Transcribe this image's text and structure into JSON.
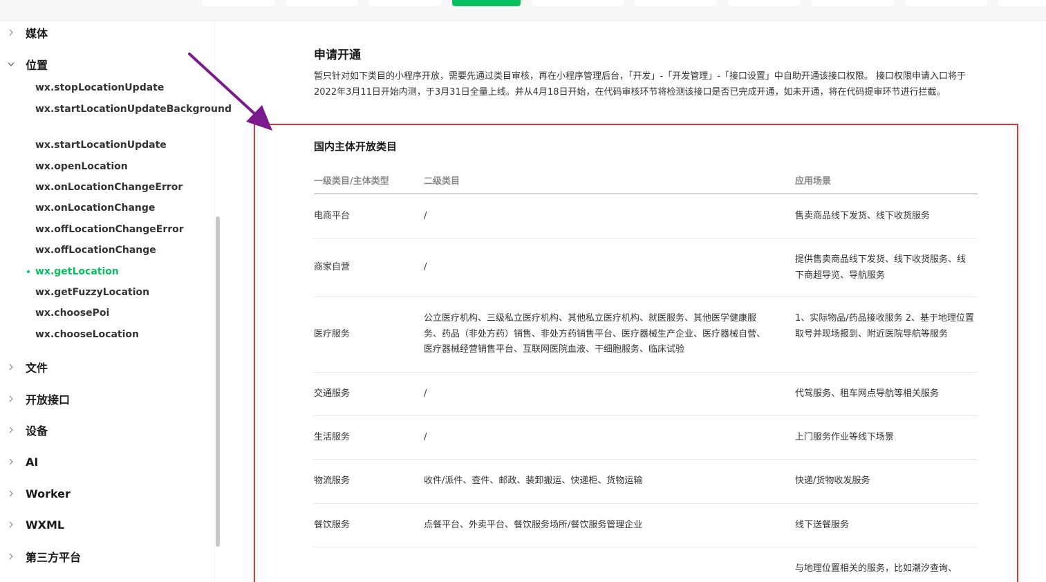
{
  "colors": {
    "accent": "#07c160",
    "highlight": "#e0303a",
    "arrow": "#7b1a8c"
  },
  "sidebar": {
    "groups_top": [
      {
        "label": "媒体",
        "expanded": false
      },
      {
        "label": "位置",
        "expanded": true
      }
    ],
    "location_items": [
      "wx.stopLocationUpdate",
      "wx.startLocationUpdateBackground",
      "wx.startLocationUpdate",
      "wx.openLocation",
      "wx.onLocationChangeError",
      "wx.onLocationChange",
      "wx.offLocationChangeError",
      "wx.offLocationChange",
      "wx.getLocation",
      "wx.getFuzzyLocation",
      "wx.choosePoi",
      "wx.chooseLocation"
    ],
    "active_item": "wx.getLocation",
    "groups_bottom": [
      "文件",
      "开放接口",
      "设备",
      "AI",
      "Worker",
      "WXML",
      "第三方平台"
    ]
  },
  "main": {
    "section_title": "申请开通",
    "description": "暂只针对如下类目的小程序开放，需要先通过类目审核，再在小程序管理后台，「开发」-「开发管理」-「接口设置」中自助开通该接口权限。 接口权限申请入口将于2022年3月11日开始内测，于3月31日全量上线。并从4月18日开始，在代码审核环节将检测该接口是否已完成开通，如未开通，将在代码提审环节进行拦截。",
    "table_title": "国内主体开放类目",
    "table": {
      "headers": [
        "一级类目/主体类型",
        "二级类目",
        "应用场景"
      ],
      "rows": [
        {
          "primary": "电商平台",
          "secondary": "/",
          "scenario": "售卖商品线下发货、线下收货服务"
        },
        {
          "primary": "商家自营",
          "secondary": "/",
          "scenario": "提供售卖商品线下发货、线下收货服务、线下商超导览、导航服务"
        },
        {
          "primary": "医疗服务",
          "secondary": "公立医疗机构、三级私立医疗机构、其他私立医疗机构、就医服务、其他医学健康服务、药品（非处方药）销售、非处方药销售平台、医疗器械生产企业、医疗器械自营、医疗器械经营销售平台、互联网医院血液、干细胞服务、临床试验",
          "scenario": "1、实际物品/药品接收服务 2、基于地理位置取号并现场报到、附近医院导航等服务"
        },
        {
          "primary": "交通服务",
          "secondary": "/",
          "scenario": "代驾服务、租车网点导航等相关服务"
        },
        {
          "primary": "生活服务",
          "secondary": "/",
          "scenario": "上门服务作业等线下场景"
        },
        {
          "primary": "物流服务",
          "secondary": "收件/派件、查件、邮政、装卸搬运、快递柜、货物运输",
          "scenario": "快递/货物收发服务"
        },
        {
          "primary": "餐饮服务",
          "secondary": "点餐平台、外卖平台、餐饮服务场所/餐饮服务管理企业",
          "scenario": "线下送餐服务"
        },
        {
          "primary": "",
          "secondary": "",
          "scenario": "与地理位置相关的服务，比如潮汐查询、"
        }
      ]
    }
  }
}
